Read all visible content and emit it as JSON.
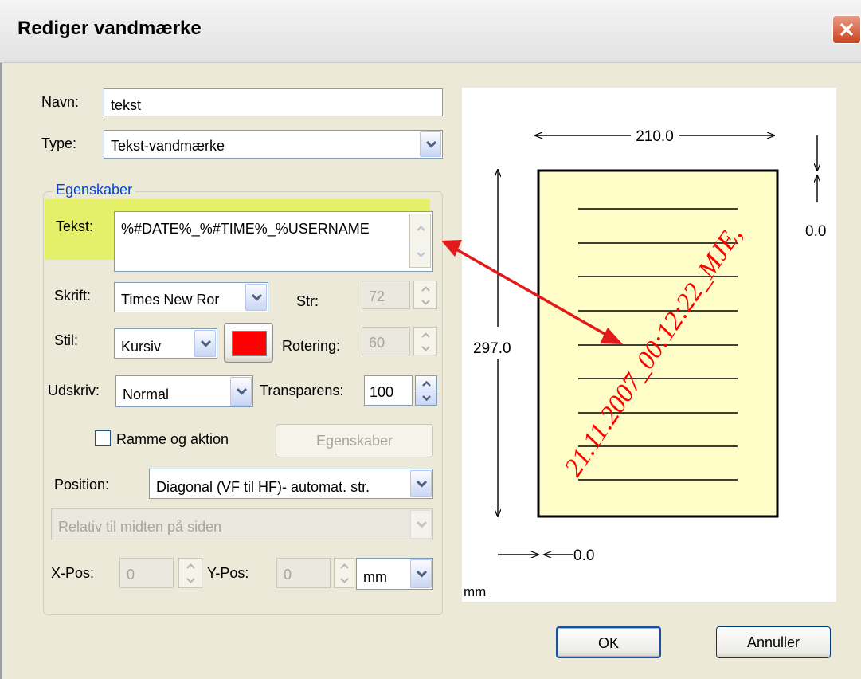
{
  "window": {
    "title": "Rediger vandmærke"
  },
  "form": {
    "name_label": "Navn:",
    "name_value": "tekst",
    "type_label": "Type:",
    "type_value": "Tekst-vandmærke",
    "group_title": "Egenskaber",
    "text_label": "Tekst:",
    "text_value": "%#DATE%_%#TIME%_%USERNAME",
    "font_label": "Skrift:",
    "font_value": "Times New Ror",
    "size_label": "Str:",
    "size_value": "72",
    "style_label": "Stil:",
    "style_value": "Kursiv",
    "color": "#ff0000",
    "rotation_label": "Rotering:",
    "rotation_value": "60",
    "print_label": "Udskriv:",
    "print_value": "Normal",
    "transparency_label": "Transparens:",
    "transparency_value": "100",
    "frame_checkbox_label": "Ramme og aktion",
    "frame_checkbox_checked": false,
    "properties_button": "Egenskaber",
    "position_label": "Position:",
    "position_value": "Diagonal (VF til HF)- automat. str.",
    "relative_value": "Relativ til midten på siden",
    "xpos_label": "X-Pos:",
    "xpos_value": "0",
    "ypos_label": "Y-Pos:",
    "ypos_value": "0",
    "unit_value": "mm"
  },
  "preview": {
    "width_dim": "210.0",
    "height_dim": "297.0",
    "right_offset": "0.0",
    "bottom_offset": "0.0",
    "unit": "mm",
    "watermark_text": "21.11.2007_00:12:22_MJE,",
    "watermark_color": "#ff0000",
    "page_color": "#fffec8",
    "highlight_color": "#e2f240",
    "arrow_color": "#e21a1a"
  },
  "buttons": {
    "ok": "OK",
    "cancel": "Annuller"
  }
}
